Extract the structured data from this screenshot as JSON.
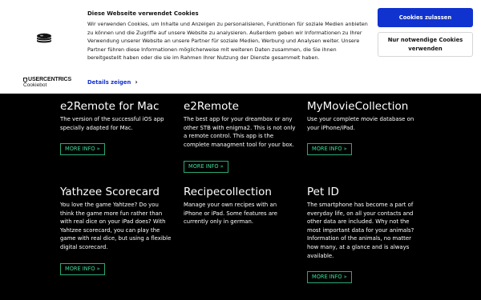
{
  "cookie_banner": {
    "title": "Diese Webseite verwendet Cookies",
    "text": "Wir verwenden Cookies, um Inhalte und Anzeigen zu personalisieren, Funktionen für soziale Medien anbieten zu können und die Zugriffe auf unsere Website zu analysieren. Außerdem geben wir Informationen zu Ihrer Verwendung unserer Website an unsere Partner für soziale Medien, Werbung und Analysen weiter. Unsere Partner führen diese Informationen möglicherweise mit weiteren Daten zusammen, die Sie ihnen bereitgestellt haben oder die sie im Rahmen Ihrer Nutzung der Dienste gesammelt haben.",
    "details_link": "Details zeigen",
    "allow_button": "Cookies zulassen",
    "necessary_button": "Nur notwendige Cookies verwenden",
    "brand": "USERCENTRICS",
    "brand_sub": "Cookiebot",
    "accent_color": "#1032cf"
  },
  "products": [
    {
      "title": "e2Remote for Mac",
      "description": "The version of the successful iOS app specially adapted for Mac.",
      "button": "MORE INFO »"
    },
    {
      "title": "e2Remote",
      "description": "The best app for your dreambox or any other STB with enigma2. This is not only a remote control. This app is the complete managment tool for your box.",
      "button": "MORE INFO »"
    },
    {
      "title": "MyMovieCollection",
      "description": "Use your complete movie database on your iPhone/iPad.",
      "button": "MORE INFO »"
    },
    {
      "title": "Yathzee Scorecard",
      "description": "You love the game Yahtzee? Do you think the game more fun rather than with real dice on your iPad does? With Yahtzee scorecard, you can play the game with real dice, but using a flexible digital scorecard.",
      "button": "MORE INFO »"
    },
    {
      "title": "Recipecollection",
      "description": "Manage your own recipes with an iPhone or iPad. Some features are currently only in german.",
      "button": "MORE INFO »"
    },
    {
      "title": "Pet ID",
      "description": "The smartphone has become a part of everyday life, on all your contacts and other data are included. Why not the most important data for your animals? Information of the animals, no matter how many, at a glance and is always available.",
      "button": "MORE INFO »"
    }
  ],
  "button_color": "#3ddc97"
}
